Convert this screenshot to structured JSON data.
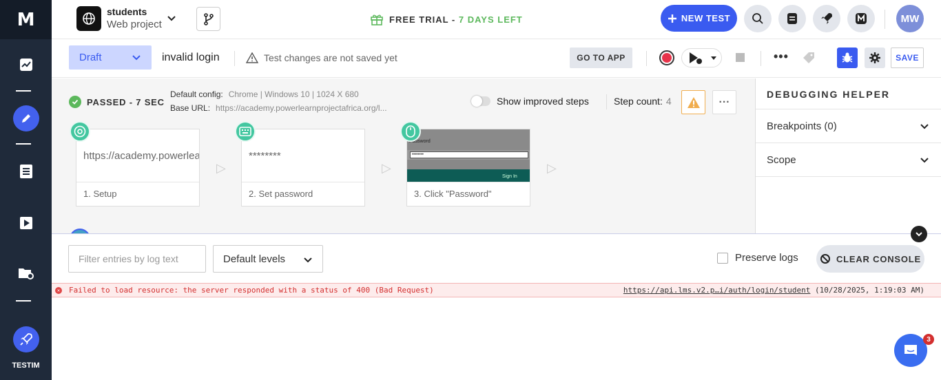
{
  "sidebar": {
    "logo": "M",
    "brand_label": "TESTIM"
  },
  "header": {
    "project_name": "students",
    "project_type": "Web project",
    "trial_prefix": "FREE TRIAL - ",
    "trial_days": "7 DAYS LEFT",
    "new_test_label": "NEW TEST",
    "avatar_initials": "MW"
  },
  "toolbar": {
    "status_select": "Draft",
    "test_name": "invalid login",
    "unsaved_warning": "Test changes are not saved yet",
    "goto_app_label": "GO TO APP",
    "save_label": "SAVE"
  },
  "run": {
    "status": "PASSED - 7 SEC",
    "default_config_label": "Default config:",
    "default_config_value": "Chrome | Windows 10 | 1024 X 680",
    "base_url_label": "Base URL:",
    "base_url_value": "https://academy.powerlearnprojectafrica.org/l...",
    "improved_steps_label": "Show improved steps",
    "step_count_label": "Step count:",
    "step_count_value": "4"
  },
  "steps": [
    {
      "body": "https://academy.powerlearnprojectafrica.org/",
      "caption": "1. Setup",
      "icon": "chrome-icon"
    },
    {
      "body": "********",
      "caption": "2. Set password",
      "icon": "keyboard-icon"
    },
    {
      "caption": "3. Click \"Password\"",
      "icon": "mouse-icon",
      "thumb_label": "Password",
      "thumb_value": "••••••••",
      "thumb_button": "Sign In"
    }
  ],
  "debug_helper": {
    "title": "DEBUGGING HELPER",
    "breakpoints_label": "Breakpoints (0)",
    "scope_label": "Scope"
  },
  "console": {
    "filter_placeholder": "Filter entries by log text",
    "levels_value": "Default levels",
    "preserve_label": "Preserve logs",
    "clear_label": "CLEAR CONSOLE",
    "log": {
      "message": "Failed to load resource: the server responded with a status of 400 (Bad Request)",
      "source_link": "https://api.lms.v2.p…i/auth/login/student",
      "timestamp": "(10/28/2025, 1:19:03 AM)"
    },
    "chat_badge": "3"
  },
  "colors": {
    "accent": "#3a5bf0",
    "rail": "#1f2a3a",
    "success": "#5cb85c",
    "error": "#d32f2f",
    "warning": "#f0ad4e"
  }
}
